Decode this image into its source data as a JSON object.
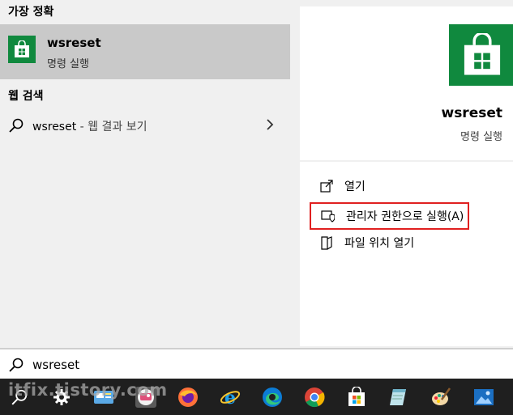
{
  "left": {
    "best_match_header": "가장 정확",
    "best_match": {
      "title": "wsreset",
      "subtitle": "명령 실행",
      "icon": "store-icon"
    },
    "web_search_header": "웹 검색",
    "web_result": {
      "query": "wsreset",
      "suffix": " - 웹 결과 보기"
    }
  },
  "detail": {
    "title": "wsreset",
    "subtitle": "명령 실행",
    "actions": [
      {
        "label": "열기",
        "icon": "open-icon"
      },
      {
        "label": "관리자 권한으로 실행(A)",
        "icon": "shield-icon",
        "highlighted": true
      },
      {
        "label": "파일 위치 열기",
        "icon": "folder-icon"
      }
    ]
  },
  "search": {
    "value": "wsreset"
  },
  "watermark": "itfix.tistory.com",
  "colors": {
    "store_green": "#10893e",
    "selected_row": "#c9c9c9",
    "highlight_border": "#e02020",
    "taskbar": "#1f1f1f"
  },
  "taskbar_icons": [
    "search-icon",
    "settings-icon",
    "control-panel-icon",
    "photo-app-icon",
    "firefox-icon",
    "internet-explorer-icon",
    "edge-icon",
    "chrome-icon",
    "store-icon",
    "notepad-icon",
    "paint-icon",
    "photos-icon"
  ]
}
